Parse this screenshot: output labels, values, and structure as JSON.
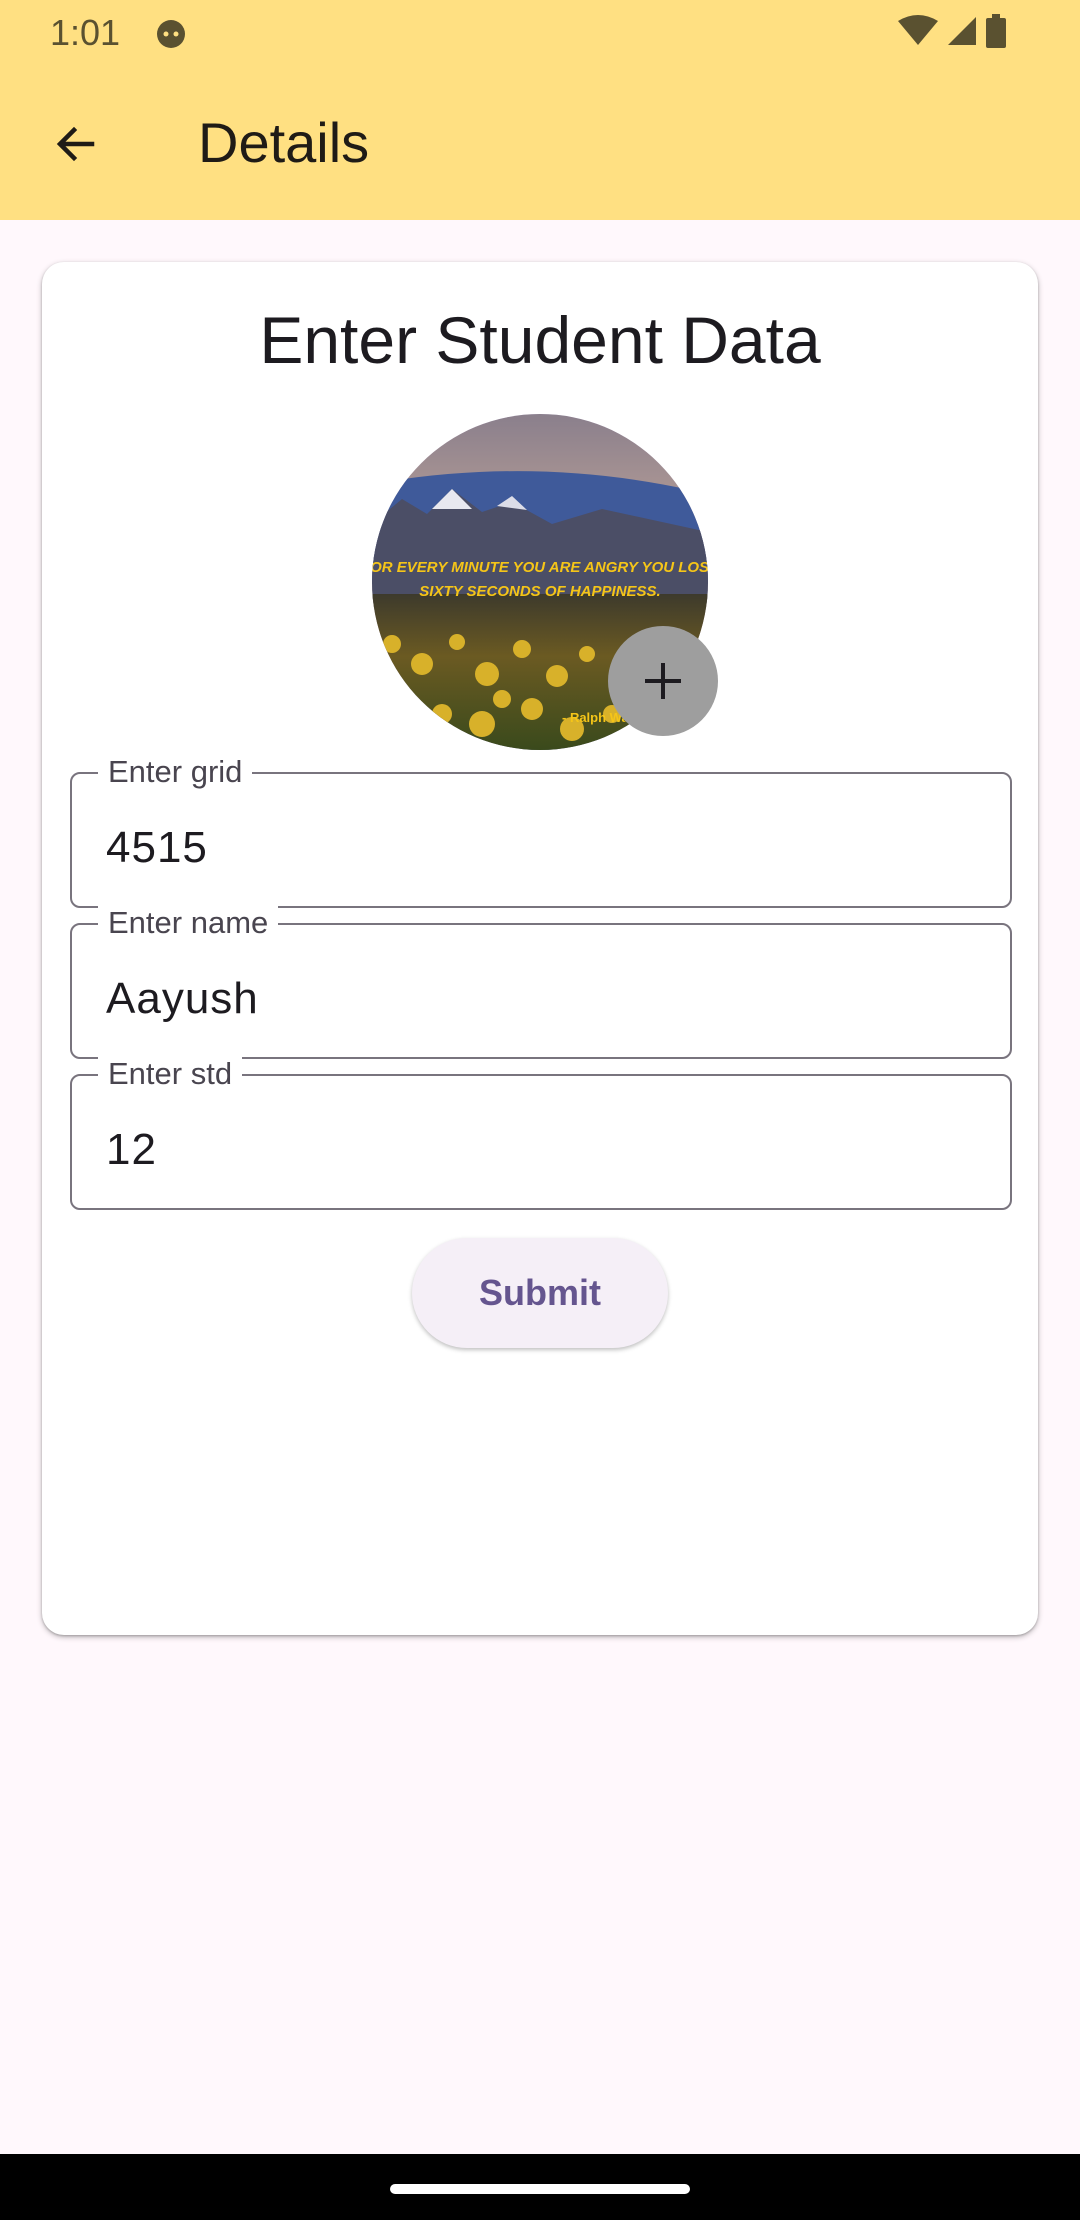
{
  "status_bar": {
    "time": "1:01",
    "icons": [
      "face-icon",
      "wifi-icon",
      "signal-icon",
      "battery-icon"
    ]
  },
  "toolbar": {
    "back_icon": "arrow-back-icon",
    "title": "Details"
  },
  "card": {
    "title": "Enter Student Data",
    "avatar": {
      "quote_line1": "FOR EVERY MINUTE YOU ARE ANGRY YOU LOSE",
      "quote_line2": "SIXTY SECONDS OF HAPPINESS.",
      "attribution": "- Ralph Wa",
      "add_icon": "plus-icon"
    },
    "fields": [
      {
        "label": "Enter grid",
        "value": "4515"
      },
      {
        "label": "Enter name",
        "value": "Aayush"
      },
      {
        "label": "Enter std",
        "value": "12"
      }
    ],
    "submit_label": "Submit"
  },
  "colors": {
    "app_bar": "#ffe082",
    "background": "#fff8fc",
    "accent": "#65558f"
  }
}
